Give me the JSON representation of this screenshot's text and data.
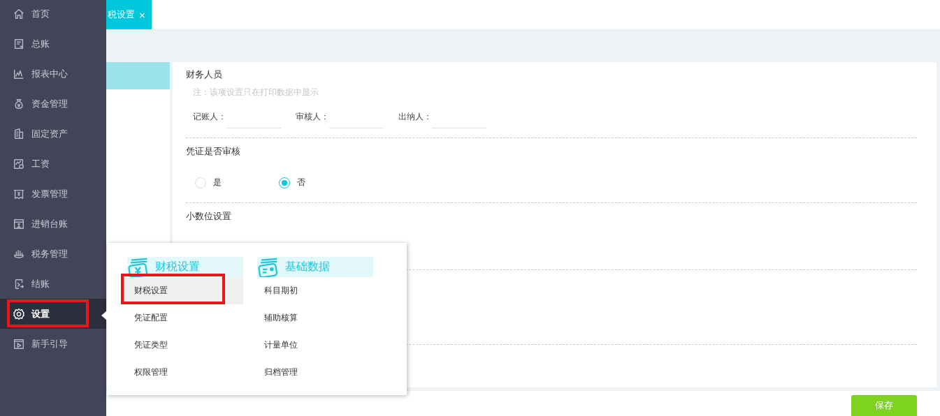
{
  "sidebar": {
    "items": [
      {
        "label": "首页",
        "kind": "home",
        "selected": false,
        "annotated": false
      },
      {
        "label": "总账",
        "kind": "ledger",
        "selected": false,
        "annotated": false
      },
      {
        "label": "报表中心",
        "kind": "chart",
        "selected": false,
        "annotated": false
      },
      {
        "label": "资金管理",
        "kind": "moneybag",
        "selected": false,
        "annotated": false
      },
      {
        "label": "固定资产",
        "kind": "building",
        "selected": false,
        "annotated": false
      },
      {
        "label": "工资",
        "kind": "salary",
        "selected": false,
        "annotated": false
      },
      {
        "label": "发票管理",
        "kind": "invoice",
        "selected": false,
        "annotated": false
      },
      {
        "label": "进销台账",
        "kind": "window",
        "selected": false,
        "annotated": false
      },
      {
        "label": "税务管理",
        "kind": "hand",
        "selected": false,
        "annotated": false
      },
      {
        "label": "结账",
        "kind": "checkout",
        "selected": false,
        "annotated": false
      },
      {
        "label": "设置",
        "kind": "gear",
        "selected": true,
        "annotated": true
      },
      {
        "label": "新手引导",
        "kind": "play",
        "selected": false,
        "annotated": false
      }
    ]
  },
  "tab": {
    "label": "税设置",
    "close": "×"
  },
  "staff": {
    "title": "财务人员",
    "note": "注：该项设置只在打印数据中显示",
    "fields": [
      {
        "label": "记账人："
      },
      {
        "label": "审核人："
      },
      {
        "label": "出纳人："
      }
    ]
  },
  "audit": {
    "title": "凭证是否审核",
    "options": [
      {
        "label": "是",
        "selected": false
      },
      {
        "label": "否",
        "selected": true
      }
    ]
  },
  "decimal": {
    "title": "小数位设置"
  },
  "save_button": "保存",
  "popup": {
    "columns": [
      {
        "title": "财税设置",
        "kind": "card",
        "items": [
          {
            "label": "财税设置",
            "selected": true,
            "annotated": true
          },
          {
            "label": "凭证配置",
            "selected": false,
            "annotated": false
          },
          {
            "label": "凭证类型",
            "selected": false,
            "annotated": false
          },
          {
            "label": "权限管理",
            "selected": false,
            "annotated": false
          }
        ]
      },
      {
        "title": "基础数据",
        "kind": "idcard",
        "items": [
          {
            "label": "科目期初",
            "selected": false,
            "annotated": false
          },
          {
            "label": "辅助核算",
            "selected": false,
            "annotated": false
          },
          {
            "label": "计量单位",
            "selected": false,
            "annotated": false
          },
          {
            "label": "归档管理",
            "selected": false,
            "annotated": false
          }
        ]
      }
    ]
  }
}
